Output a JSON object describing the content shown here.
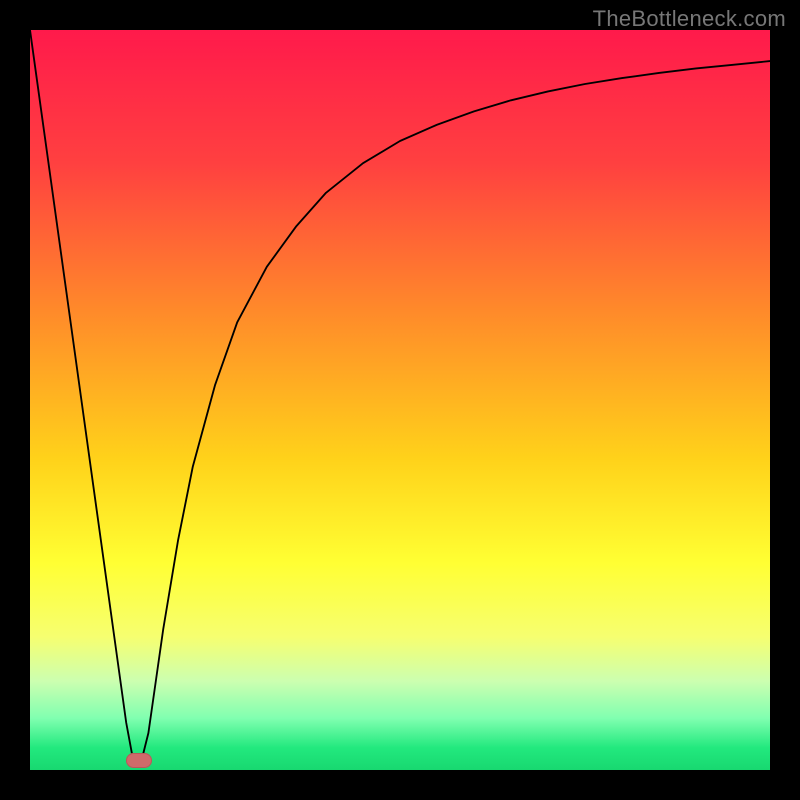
{
  "watermark": "TheBottleneck.com",
  "colors": {
    "frame": "#000000",
    "curve": "#000000",
    "marker_fill": "#cf6a6a",
    "marker_stroke": "#b65a5a",
    "gradient_stops": [
      {
        "offset": 0.0,
        "color": "#ff1a4b"
      },
      {
        "offset": 0.18,
        "color": "#ff4040"
      },
      {
        "offset": 0.38,
        "color": "#ff8a2a"
      },
      {
        "offset": 0.58,
        "color": "#ffd21a"
      },
      {
        "offset": 0.72,
        "color": "#ffff33"
      },
      {
        "offset": 0.82,
        "color": "#f6ff70"
      },
      {
        "offset": 0.88,
        "color": "#ccffb0"
      },
      {
        "offset": 0.93,
        "color": "#80ffb0"
      },
      {
        "offset": 0.97,
        "color": "#22e97e"
      },
      {
        "offset": 1.0,
        "color": "#18d870"
      }
    ]
  },
  "chart_data": {
    "type": "line",
    "title": "",
    "xlabel": "",
    "ylabel": "",
    "xlim": [
      0,
      100
    ],
    "ylim": [
      0,
      100
    ],
    "x": [
      0,
      2,
      4,
      6,
      8,
      10,
      12,
      13,
      14,
      15,
      16,
      17,
      18,
      20,
      22,
      25,
      28,
      32,
      36,
      40,
      45,
      50,
      55,
      60,
      65,
      70,
      75,
      80,
      85,
      90,
      95,
      100
    ],
    "values": [
      100,
      85.6,
      71.2,
      56.8,
      42.4,
      28.0,
      13.6,
      6.4,
      1.0,
      1.0,
      5.0,
      12.0,
      19.0,
      31.0,
      41.0,
      52.0,
      60.5,
      68.0,
      73.5,
      78.0,
      82.0,
      85.0,
      87.2,
      89.0,
      90.5,
      91.7,
      92.7,
      93.5,
      94.2,
      94.8,
      95.3,
      95.8
    ],
    "marker": {
      "x_range": [
        13.0,
        16.5
      ],
      "y": 0.5,
      "height": 2.0
    },
    "notes": "Values are read from the plot at the precision the axes imply (0–100 on both axes, inferred). The curve descends linearly from top-left to a minimum near x≈14, then rises steeply and asymptotically flattens toward the top-right. A small rounded marker sits at the minimum on the baseline."
  }
}
